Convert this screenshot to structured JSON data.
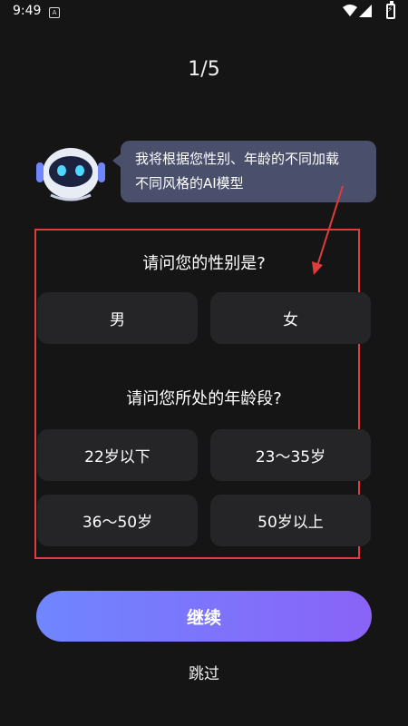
{
  "status_bar": {
    "time": "9:49",
    "notification_icon": "a-badge-icon",
    "wifi_icon": "wifi-icon",
    "signal_icon": "signal-icon",
    "battery_icon": "battery-charging-icon"
  },
  "progress": {
    "label": "1/5"
  },
  "assistant": {
    "avatar_icon": "robot-avatar-icon",
    "line1": "我将根据您性别、年龄的不同加载",
    "line2": "不同风格的AI模型"
  },
  "gender": {
    "question": "请问您的性别是?",
    "options": [
      "男",
      "女"
    ]
  },
  "age": {
    "question": "请问您所处的年龄段?",
    "options": [
      "22岁以下",
      "23～35岁",
      "36～50岁",
      "50岁以上"
    ]
  },
  "actions": {
    "continue_label": "继续",
    "skip_label": "跳过"
  },
  "colors": {
    "background": "#151516",
    "option_bg": "#252527",
    "bubble_bg": "#4a4f6c",
    "accent_start": "#6f86ff",
    "accent_end": "#8a63f7",
    "annotation_red": "#e23b3b"
  }
}
